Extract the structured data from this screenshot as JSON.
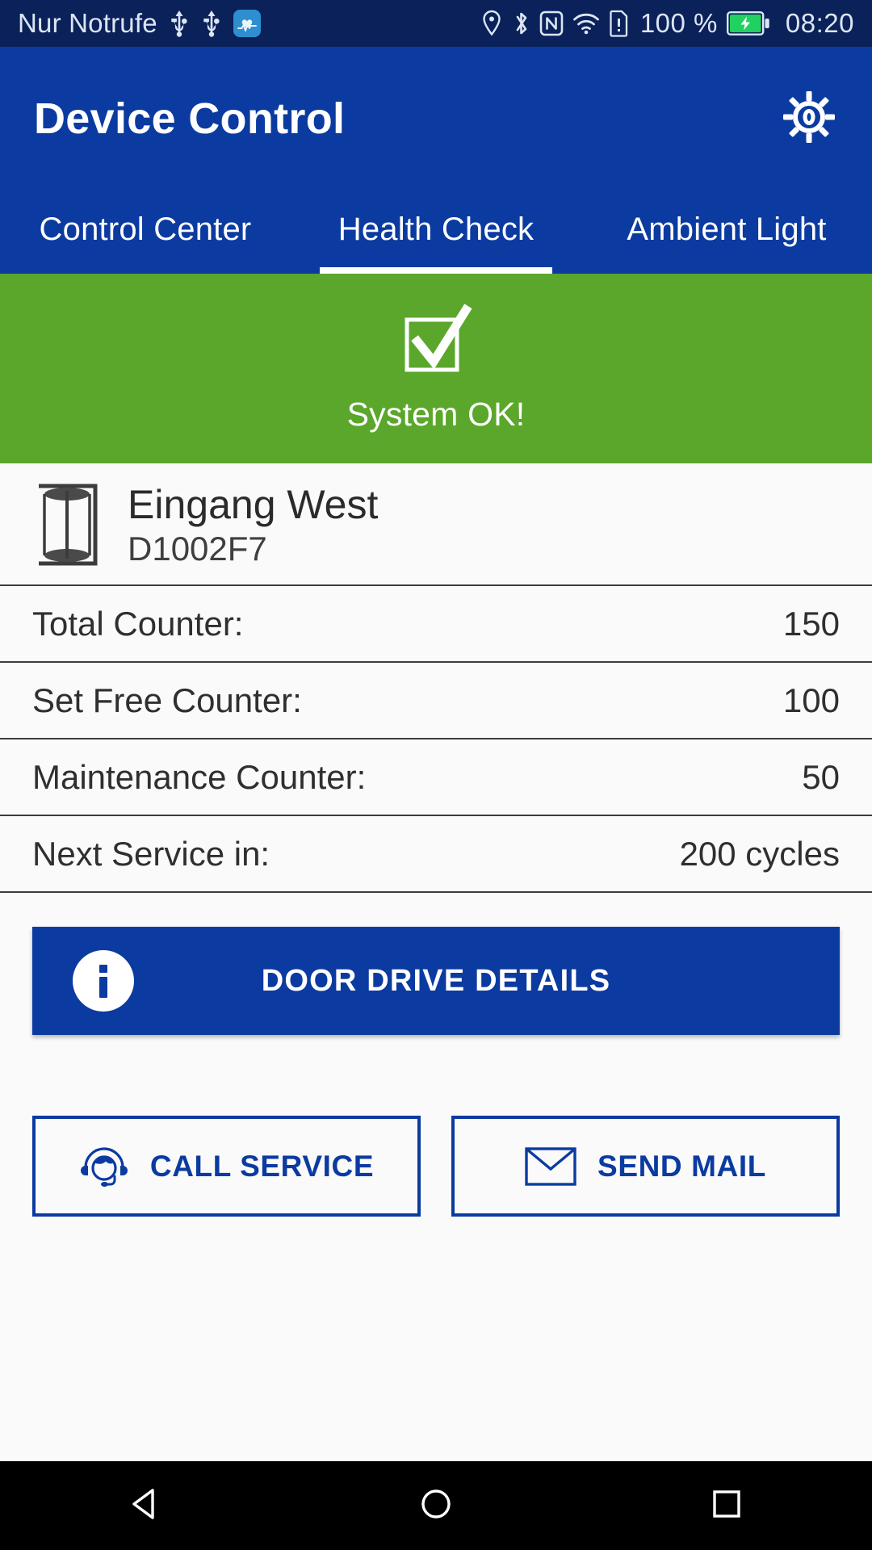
{
  "status_bar": {
    "carrier": "Nur Notrufe",
    "battery_percent": "100 %",
    "clock": "08:20",
    "icons": [
      "usb-icon",
      "usb-icon",
      "health-app-icon",
      "location-icon",
      "bluetooth-icon",
      "nfc-icon",
      "wifi-icon",
      "sim-alert-icon",
      "battery-charging-icon"
    ]
  },
  "appbar": {
    "title": "Device Control",
    "settings_icon": "gear-icon",
    "background": "#0b3ba0"
  },
  "tabs": [
    {
      "label": "Control Center",
      "active": false
    },
    {
      "label": "Health Check",
      "active": true
    },
    {
      "label": "Ambient Light",
      "active": false
    }
  ],
  "banner": {
    "icon": "checkbox-checked-icon",
    "text": "System OK!",
    "background": "#5aa72b"
  },
  "device": {
    "icon": "revolving-door-icon",
    "name": "Eingang West",
    "id": "D1002F7"
  },
  "counters": [
    {
      "label": "Total Counter:",
      "value": "150"
    },
    {
      "label": "Set Free Counter:",
      "value": "100"
    },
    {
      "label": "Maintenance Counter:",
      "value": "50"
    },
    {
      "label": "Next Service in:",
      "value": "200 cycles"
    }
  ],
  "primary_button": {
    "label": "DOOR DRIVE DETAILS",
    "icon": "info-icon",
    "background": "#0b3ba0"
  },
  "secondary_buttons": [
    {
      "label": "CALL SERVICE",
      "icon": "headset-support-icon"
    },
    {
      "label": "SEND MAIL",
      "icon": "envelope-icon"
    }
  ],
  "navbar": {
    "back": "back-triangle-icon",
    "home": "home-circle-icon",
    "recents": "recents-square-icon"
  },
  "colors": {
    "brand_blue": "#0b3ba0",
    "status_bar_blue": "#0a2259",
    "ok_green": "#5aa72b",
    "page_background": "#fafafa"
  }
}
